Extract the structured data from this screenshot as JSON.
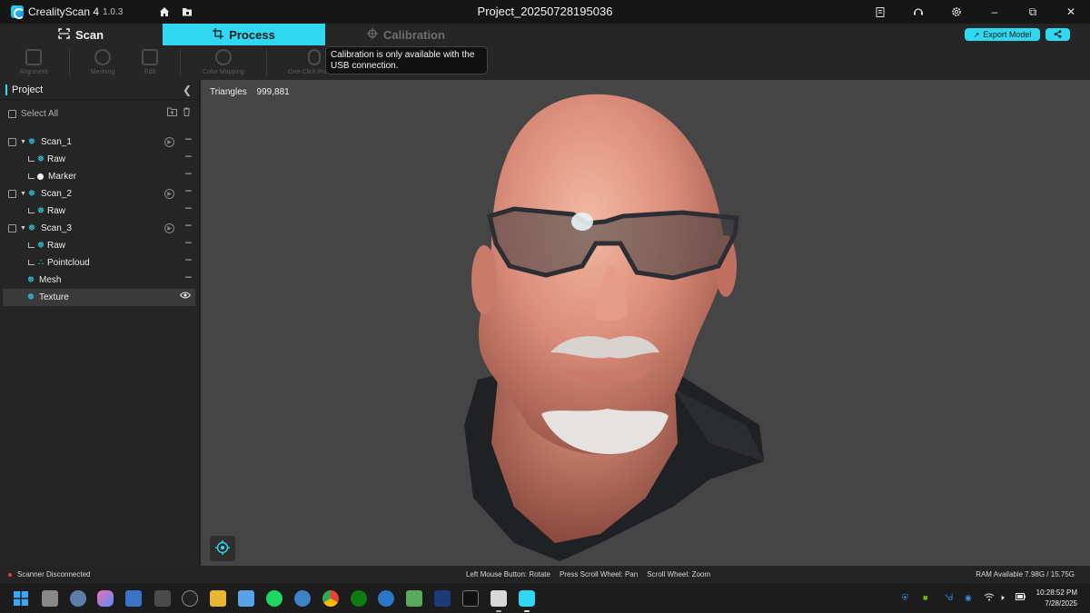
{
  "titlebar": {
    "app_name": "CrealityScan 4",
    "app_version": "1.0.3",
    "document_title": "Project_20250728195036"
  },
  "modes": {
    "scan": "Scan",
    "process": "Process",
    "calibration": "Calibration",
    "active": "Process"
  },
  "header_actions": {
    "export_label": "Export Model"
  },
  "toolbar": {
    "items": [
      {
        "label": "Alignment",
        "icon": "alignment-icon"
      },
      {
        "label": "Meshing",
        "icon": "meshing-icon"
      },
      {
        "label": "Edit",
        "icon": "edit-icon"
      },
      {
        "label": "Color Mapping",
        "icon": "color-mapping-icon"
      },
      {
        "label": "One-Click Process",
        "icon": "one-click-icon"
      }
    ],
    "tooltip": "Calibration is only available with the USB connection."
  },
  "project": {
    "title": "Project",
    "select_all": "Select All",
    "tree": [
      {
        "name": "Scan_1",
        "level": 0
      },
      {
        "name": "Raw",
        "level": 1
      },
      {
        "name": "Marker",
        "level": 1
      },
      {
        "name": "Scan_2",
        "level": 0
      },
      {
        "name": "Raw",
        "level": 1
      },
      {
        "name": "Scan_3",
        "level": 0
      },
      {
        "name": "Raw",
        "level": 1
      },
      {
        "name": "Pointcloud",
        "level": 1
      },
      {
        "name": "Mesh",
        "level": 0
      },
      {
        "name": "Texture",
        "level": 0,
        "selected": true
      }
    ]
  },
  "viewport": {
    "triangles_label": "Triangles",
    "triangles_value": "999,881"
  },
  "status": {
    "scanner": "Scanner Disconnected",
    "hint_rotate": "Left Mouse Button: Rotate",
    "hint_pan": "Press Scroll Wheel: Pan",
    "hint_zoom": "Scroll Wheel: Zoom",
    "ram": "RAM Available 7.98G / 15.75G"
  },
  "taskbar": {
    "time": "10:28:52 PM",
    "date": "7/28/2025"
  },
  "colors": {
    "accent": "#2fd7f0",
    "status_error": "#e83a3a"
  }
}
